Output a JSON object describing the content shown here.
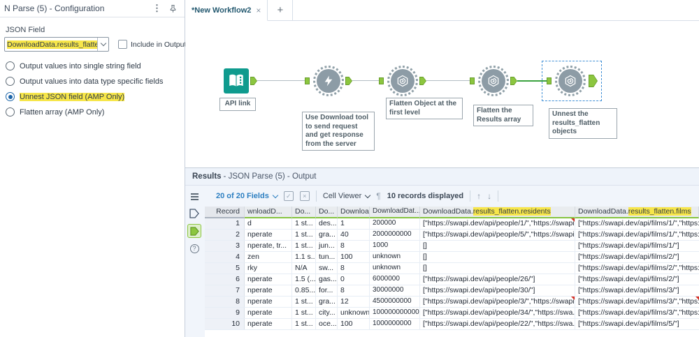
{
  "colors": {
    "highlight_yellow": "#f7e64a",
    "anchor_green": "#8cc63f",
    "anchor_green_border": "#679d2c",
    "wire_green": "#3ba23f",
    "tool_gray": "#8d9ca6",
    "text_input_teal": "#0f9b8e",
    "selection_blue": "#3f8fd6",
    "link_blue": "#2d7fc1",
    "red_marker": "#d93025"
  },
  "icons": {
    "kebab_menu": "vertical-ellipsis",
    "pin": "pushpin-outline",
    "tab_close": "×",
    "add_tab": "+",
    "dropdown_chevron": "chevron-down",
    "select_fields": "check-square",
    "clear_fields": "x-square",
    "pilcrow": "¶",
    "up_arrow": "↑",
    "down_arrow": "↓",
    "list_view": "hamburger-lines",
    "output_anchor": "pentagon",
    "help": "?"
  },
  "config_panel": {
    "title": "N Parse (5) - Configuration",
    "json_field_label": "JSON Field",
    "dropdown_value": "DownloadData.results_flatten",
    "include_checkbox_label": "Include in Output",
    "options": [
      {
        "label": "Output values into single string field",
        "selected": false,
        "highlighted": false
      },
      {
        "label": "Output values into data type specific fields",
        "selected": false,
        "highlighted": false
      },
      {
        "label": "Unnest JSON field (AMP Only)",
        "selected": true,
        "highlighted": true
      },
      {
        "label": "Flatten array (AMP Only)",
        "selected": false,
        "highlighted": false
      }
    ]
  },
  "canvas": {
    "tab": {
      "label": "*New Workflow2",
      "close": "×",
      "new_tab": "+"
    },
    "tools": [
      {
        "type": "text-input",
        "annotation": "API link"
      },
      {
        "type": "download",
        "annotation": "Use Download tool to send request and get response from the server"
      },
      {
        "type": "json-parse",
        "annotation": "Flatten Object at the first level"
      },
      {
        "type": "json-parse",
        "annotation": "Flatten the Results array"
      },
      {
        "type": "json-parse",
        "annotation": "Unnest the results_flatten objects",
        "selected": true
      }
    ]
  },
  "results": {
    "title_bold": "Results",
    "title_rest": "- JSON Parse (5) - Output",
    "toolbar": {
      "fields_dropdown": "20 of 20 Fields",
      "cell_viewer": "Cell Viewer",
      "records_text": "10 records displayed",
      "up_arrow": "↑",
      "down_arrow": "↓",
      "pilcrow": "¶"
    },
    "table": {
      "columns": [
        {
          "label": "Record"
        },
        {
          "label": "wnloadD..."
        },
        {
          "label": "Do..."
        },
        {
          "label": "Do..."
        },
        {
          "label": "Downloa..."
        },
        {
          "label": "DownloadDat..."
        },
        {
          "prefix": "DownloadData.",
          "highlight": "results_flatten.residents"
        },
        {
          "prefix": "DownloadData.",
          "highlight": "results_flatten.films"
        }
      ],
      "rows": [
        [
          "1",
          "d",
          "1 st...",
          "des...",
          "1",
          "200000",
          "[\"https://swapi.dev/api/people/1/\",\"https://swapi....",
          "[\"https://swapi.dev/api/films/1/\",\"https://s"
        ],
        [
          "2",
          "nperate",
          "1 st...",
          "gra...",
          "40",
          "2000000000",
          "[\"https://swapi.dev/api/people/5/\",\"https://swapi....",
          "[\"https://swapi.dev/api/films/1/\",\"https://s"
        ],
        [
          "3",
          "nperate, tr...",
          "1 st...",
          "jun...",
          "8",
          "1000",
          "[]",
          "[\"https://swapi.dev/api/films/1/\"]"
        ],
        [
          "4",
          "zen",
          "1.1 s...",
          "tun...",
          "100",
          "unknown",
          "[]",
          "[\"https://swapi.dev/api/films/2/\"]"
        ],
        [
          "5",
          "rky",
          "N/A",
          "sw...",
          "8",
          "unknown",
          "[]",
          "[\"https://swapi.dev/api/films/2/\",\"https://s"
        ],
        [
          "6",
          "nperate",
          "1.5 (...",
          "gas...",
          "0",
          "6000000",
          "[\"https://swapi.dev/api/people/26/\"]",
          "[\"https://swapi.dev/api/films/2/\"]"
        ],
        [
          "7",
          "nperate",
          "0.85...",
          "for...",
          "8",
          "30000000",
          "[\"https://swapi.dev/api/people/30/\"]",
          "[\"https://swapi.dev/api/films/3/\"]"
        ],
        [
          "8",
          "nperate",
          "1 st...",
          "gra...",
          "12",
          "4500000000",
          "[\"https://swapi.dev/api/people/3/\",\"https://swapi....",
          "[\"https://swapi.dev/api/films/3/\",\"https://s"
        ],
        [
          "9",
          "nperate",
          "1 st...",
          "city...",
          "unknown",
          "1000000000000",
          "[\"https://swapi.dev/api/people/34/\",\"https://swa...",
          "[\"https://swapi.dev/api/films/3/\",\"https://s"
        ],
        [
          "10",
          "nperate",
          "1 st...",
          "oce...",
          "100",
          "1000000000",
          "[\"https://swapi.dev/api/people/22/\",\"https://swa...",
          "[\"https://swapi.dev/api/films/5/\"]"
        ]
      ],
      "red_markers": [
        [
          0,
          6
        ],
        [
          7,
          6
        ],
        [
          7,
          7
        ]
      ]
    }
  }
}
